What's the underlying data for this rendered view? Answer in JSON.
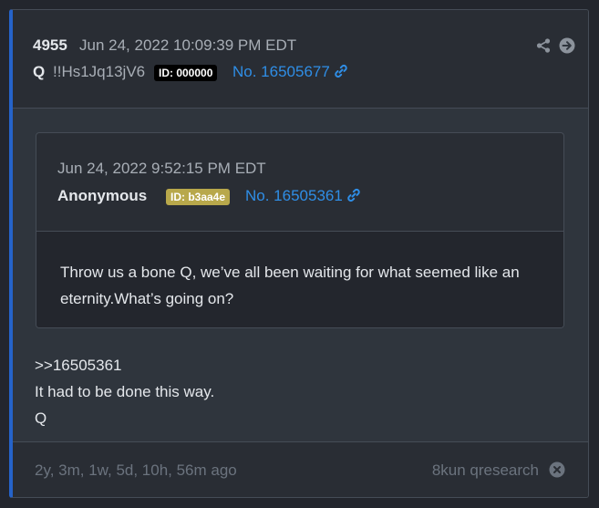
{
  "post": {
    "number": "4955",
    "date": "Jun 24, 2022 10:09:39 PM EDT",
    "author": "Q",
    "tripcode": "!!Hs1Jq13jV6",
    "id_label": "ID: 000000",
    "post_link": "No. 16505677"
  },
  "actions": {
    "share_icon": "share-icon",
    "go_icon": "arrow-right-circle-icon"
  },
  "quote": {
    "date": "Jun 24, 2022 9:52:15 PM EDT",
    "author": "Anonymous",
    "id_label": "ID: b3aa4e",
    "id_color": "#b8a84b",
    "post_link": "No. 16505361",
    "text": "Throw us a bone Q, we’ve all been waiting for what seemed like an eternity.What’s going on?"
  },
  "body": {
    "line1": ">>16505361",
    "line2": "It had to be done this way.",
    "line3": "Q"
  },
  "footer": {
    "ago": "2y, 3m, 1w, 5d, 10h, 56m ago",
    "source": "8kun qresearch",
    "close_icon": "close-circle-icon"
  },
  "colors": {
    "accent": "#2563c9",
    "link": "#2f8ee6",
    "id_main_bg": "#000000"
  }
}
